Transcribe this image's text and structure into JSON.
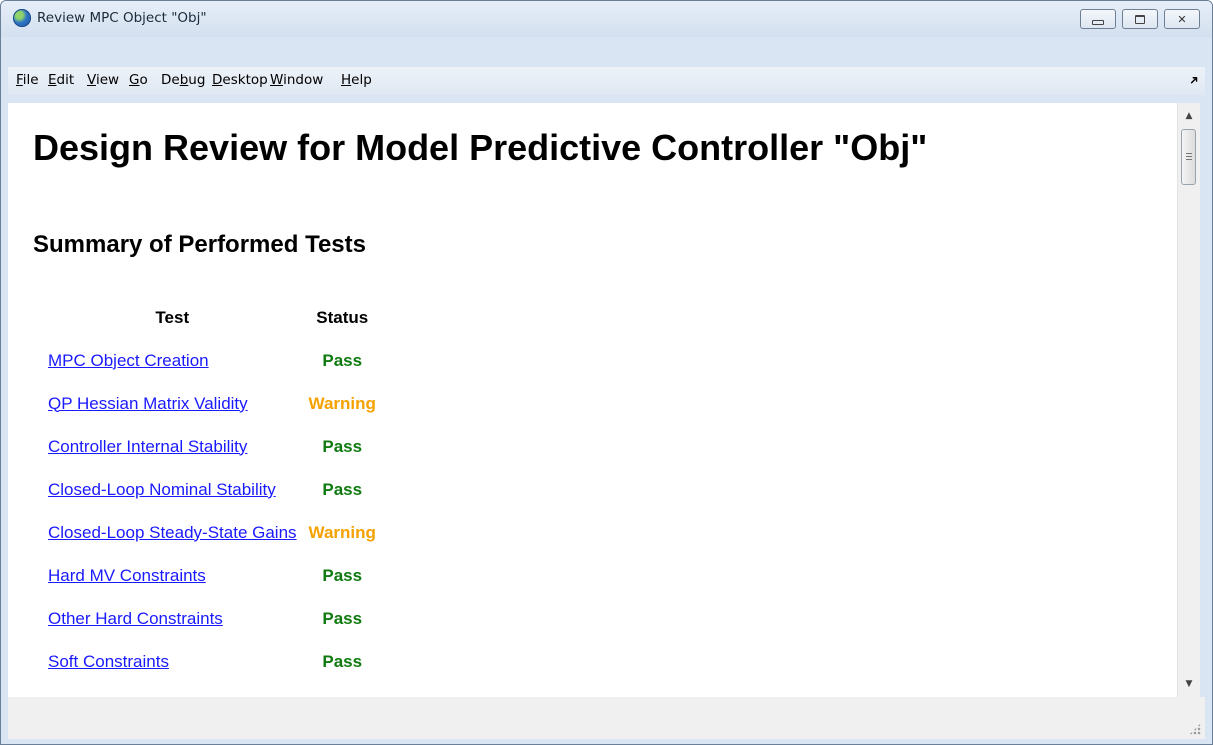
{
  "window": {
    "title": "Review MPC Object \"Obj\""
  },
  "menu": {
    "items": [
      {
        "label": "File",
        "mnemonic": "F",
        "rest": "ile"
      },
      {
        "label": "Edit",
        "mnemonic": "E",
        "rest": "dit"
      },
      {
        "label": "View",
        "mnemonic": "V",
        "rest": "iew"
      },
      {
        "label": "Go",
        "mnemonic": "G",
        "rest": "o"
      },
      {
        "label": "Debug",
        "pre": "De",
        "mnemonic": "b",
        "rest": "ug"
      },
      {
        "label": "Desktop",
        "mnemonic": "D",
        "rest": "esktop"
      },
      {
        "label": "Window",
        "mnemonic": "W",
        "rest": "indow"
      },
      {
        "label": "Help",
        "mnemonic": "H",
        "rest": "elp"
      }
    ],
    "corner_icon": "undock-arrow-icon",
    "corner_glyph": "➘"
  },
  "report": {
    "title": "Design Review for Model Predictive Controller \"Obj\"",
    "summary_title": "Summary of Performed Tests",
    "headers": {
      "test": "Test",
      "status": "Status"
    },
    "rows": [
      {
        "test": "MPC Object Creation",
        "status": "Pass"
      },
      {
        "test": "QP Hessian Matrix Validity",
        "status": "Warning"
      },
      {
        "test": "Controller Internal Stability",
        "status": "Pass"
      },
      {
        "test": "Closed-Loop Nominal Stability",
        "status": "Pass"
      },
      {
        "test": "Closed-Loop Steady-State Gains",
        "status": "Warning"
      },
      {
        "test": "Hard MV Constraints",
        "status": "Pass"
      },
      {
        "test": "Other Hard Constraints",
        "status": "Pass"
      },
      {
        "test": "Soft Constraints",
        "status": "Pass"
      }
    ]
  },
  "colors": {
    "pass": "#0f7a0f",
    "warning": "#f5a200",
    "link": "#1a1aff"
  },
  "scrollbar": {
    "up_glyph": "▲",
    "down_glyph": "▼"
  },
  "win_controls": {
    "close_glyph": "✕"
  }
}
